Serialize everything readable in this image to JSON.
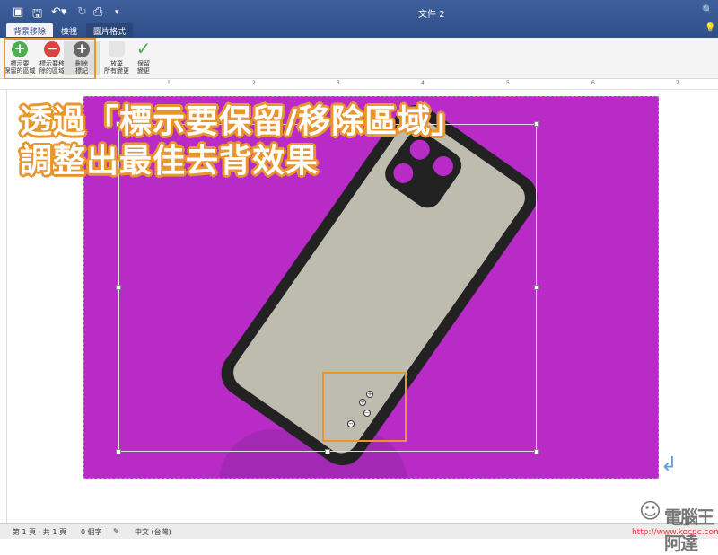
{
  "titlebar": {
    "title": "文件 2"
  },
  "tabs": [
    {
      "label": "背景移除"
    },
    {
      "label": "檢視"
    },
    {
      "label": "圖片格式"
    }
  ],
  "ribbon": {
    "buttons": [
      {
        "label1": "標示要",
        "label2": "保留的區域",
        "icon": "plus-pencil-icon"
      },
      {
        "label1": "標示要移",
        "label2": "除的區域",
        "icon": "minus-pencil-icon"
      },
      {
        "label1": "刪除",
        "label2": "標記",
        "icon": "delete-mark-icon"
      },
      {
        "label1": "放棄",
        "label2": "所有變更",
        "icon": "trash-icon"
      },
      {
        "label1": "保留",
        "label2": "變更",
        "icon": "checkmark-icon"
      }
    ]
  },
  "ruler": [
    "1",
    "2",
    "3",
    "4",
    "5",
    "6",
    "7"
  ],
  "overlay": {
    "line1": "透過「標示要保留/移除區域」",
    "line2": "調整出最佳去背效果"
  },
  "status": {
    "page": "第 1 頁 · 共 1 頁",
    "words": "0 個字",
    "language": "中文 (台灣)"
  },
  "watermark": {
    "name": "電腦王阿達",
    "url": "http://www.kocpc.com.tw"
  },
  "colors": {
    "titlebar": "#2f4f8a",
    "highlight": "#e8962e",
    "background_removal": "#b82bc7"
  }
}
